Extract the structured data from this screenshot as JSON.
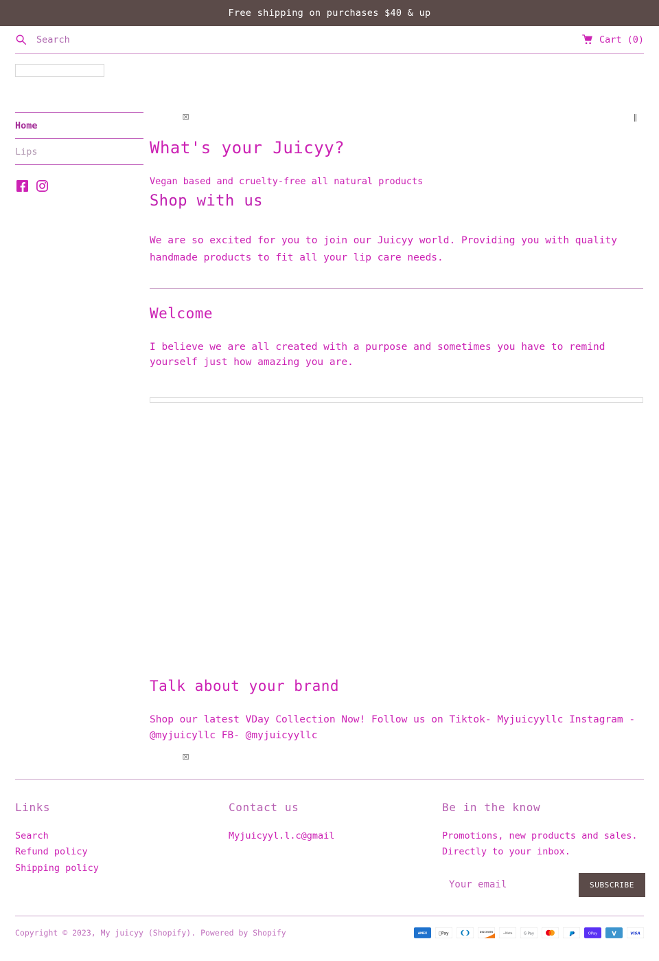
{
  "announcement": {
    "text": "Free shipping on purchases $40 & up"
  },
  "header": {
    "search_placeholder": "Search",
    "search_value": "",
    "search_icon": "search-icon",
    "cart_label": "Cart (0)",
    "cart_icon": "shopping-cart-icon"
  },
  "logo": {
    "alt": ""
  },
  "sidebar": {
    "items": [
      {
        "label": "Home",
        "state": "active"
      },
      {
        "label": "Lips",
        "state": "muted"
      }
    ],
    "social": [
      {
        "name": "facebook-icon",
        "label": "Facebook"
      },
      {
        "name": "instagram-icon",
        "label": "Instagram"
      }
    ]
  },
  "main": {
    "broken_image_glyph": "☒",
    "broken_image_glyph_right": "‖",
    "heading": "What's your Juicyy?",
    "subheading": "Vegan based and cruelty-free all natural products",
    "shop_heading": "Shop with us",
    "intro": "We are so excited for you to join our Juicyy world. Providing you with quality handmade products to fit all your lip care needs.",
    "welcome_heading": "Welcome",
    "welcome_copy": "I believe we are all created with a purpose and sometimes you have to remind yourself just how amazing you are.",
    "brand_heading": "Talk about your brand",
    "brand_copy": "Shop our latest VDay Collection Now! Follow us on Tiktok- Myjuicyyllc Instagram - @myjuicyllc FB- @myjuicyyllc"
  },
  "footer": {
    "links": {
      "title": "Links",
      "items": [
        "Search",
        "Refund policy",
        "Shipping policy"
      ]
    },
    "contact": {
      "title": "Contact us",
      "email": "Myjuicyyl.l.c@gmail"
    },
    "newsletter": {
      "title": "Be in the know",
      "line1": "Promotions, new products and sales.",
      "line2": "Directly to your inbox.",
      "email_placeholder": "Your email",
      "email_value": "",
      "subscribe_label": "SUBSCRIBE"
    }
  },
  "bottom": {
    "copyright": "Copyright © 2023,",
    "shop_name": "My juicyy (Shopify).",
    "powered": "Powered by Shopify",
    "payments": [
      {
        "name": "amex-icon",
        "label": "AMEX",
        "bg": "#1F72CD",
        "fg": "#ffffff"
      },
      {
        "name": "apple-pay-icon",
        "label": "Pay",
        "bg": "#ffffff",
        "fg": "#000000"
      },
      {
        "name": "diners-club-icon",
        "label": "DC",
        "bg": "#ffffff",
        "fg": "#0079BE"
      },
      {
        "name": "discover-icon",
        "label": "DISCOVER",
        "bg": "#ffffff",
        "fg": "#4D4D4D"
      },
      {
        "name": "meta-pay-icon",
        "label": "Meta",
        "bg": "#ffffff",
        "fg": "#555555"
      },
      {
        "name": "google-pay-icon",
        "label": "G Pay",
        "bg": "#ffffff",
        "fg": "#5F6368"
      },
      {
        "name": "mastercard-icon",
        "label": "MC",
        "bg": "#ffffff",
        "fg": "#EB001B"
      },
      {
        "name": "paypal-icon",
        "label": "P",
        "bg": "#ffffff",
        "fg": "#003087"
      },
      {
        "name": "shop-pay-icon",
        "label": "OPay",
        "bg": "#5A31F4",
        "fg": "#ffffff"
      },
      {
        "name": "venmo-icon",
        "label": "V",
        "bg": "#3D95CE",
        "fg": "#ffffff"
      },
      {
        "name": "visa-icon",
        "label": "VISA",
        "bg": "#ffffff",
        "fg": "#1434CB"
      }
    ]
  },
  "colors": {
    "accent_pink": "#cc22b4",
    "dark_brown": "#5b4b49",
    "muted_pink": "#b39ab3",
    "rule_pink": "#cba3c9"
  }
}
